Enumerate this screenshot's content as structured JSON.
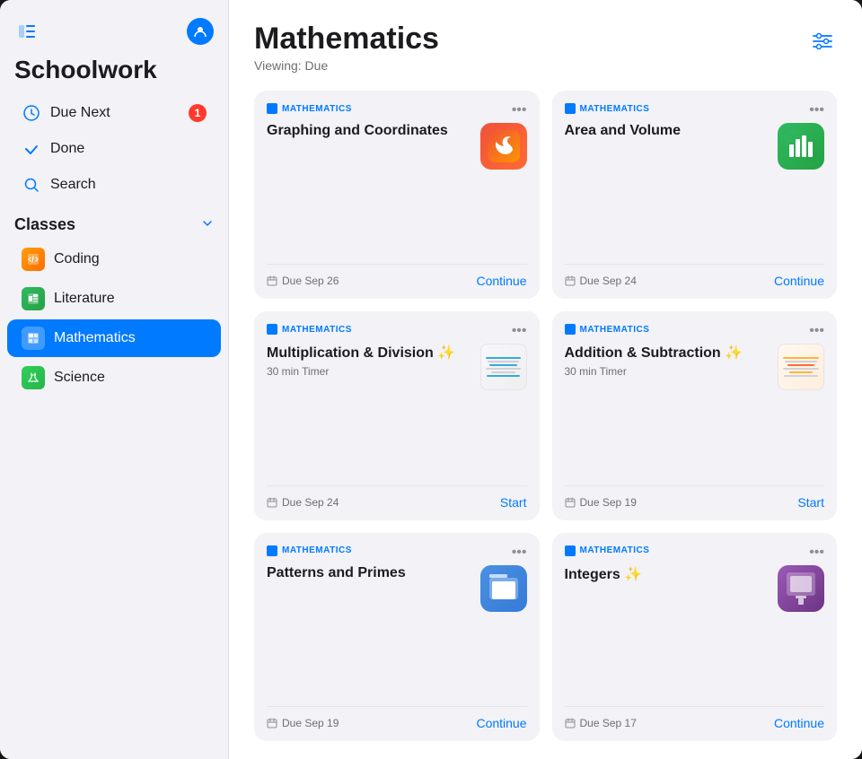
{
  "app": {
    "title": "Schoolwork"
  },
  "sidebar": {
    "toggle_icon": "sidebar-icon",
    "profile_icon": "person-icon",
    "nav_items": [
      {
        "id": "due-next",
        "label": "Due Next",
        "icon": "clock",
        "badge": "1"
      },
      {
        "id": "done",
        "label": "Done",
        "icon": "checkmark",
        "badge": null
      },
      {
        "id": "search",
        "label": "Search",
        "icon": "magnify",
        "badge": null
      }
    ],
    "classes_section": "Classes",
    "classes": [
      {
        "id": "coding",
        "label": "Coding",
        "icon": "🟧",
        "active": false
      },
      {
        "id": "literature",
        "label": "Literature",
        "icon": "📊",
        "active": false
      },
      {
        "id": "mathematics",
        "label": "Mathematics",
        "icon": "📋",
        "active": true
      },
      {
        "id": "science",
        "label": "Science",
        "icon": "🌿",
        "active": false
      }
    ]
  },
  "main": {
    "title": "Mathematics",
    "viewing_label": "Viewing: Due",
    "filter_icon": "sliders-icon",
    "cards": [
      {
        "id": "graphing",
        "category": "MATHEMATICS",
        "title": "Graphing and Coordinates",
        "subtitle": "",
        "timer": null,
        "due": "Due Sep 26",
        "action": "Continue",
        "icon_type": "swift"
      },
      {
        "id": "area-volume",
        "category": "MATHEMATICS",
        "title": "Area and Volume",
        "subtitle": "",
        "timer": null,
        "due": "Due Sep 24",
        "action": "Continue",
        "icon_type": "numbers"
      },
      {
        "id": "multiplication",
        "category": "MATHEMATICS",
        "title": "Multiplication & Division ✨",
        "subtitle": "30 min Timer",
        "timer": true,
        "due": "Due Sep 24",
        "action": "Start",
        "icon_type": "thumb"
      },
      {
        "id": "addition",
        "category": "MATHEMATICS",
        "title": "Addition & Subtraction ✨",
        "subtitle": "30 min Timer",
        "timer": true,
        "due": "Due Sep 19",
        "action": "Start",
        "icon_type": "thumb2"
      },
      {
        "id": "patterns",
        "category": "MATHEMATICS",
        "title": "Patterns and Primes",
        "subtitle": "",
        "timer": null,
        "due": "Due Sep 19",
        "action": "Continue",
        "icon_type": "files"
      },
      {
        "id": "integers",
        "category": "MATHEMATICS",
        "title": "Integers ✨",
        "subtitle": "",
        "timer": null,
        "due": "Due Sep 17",
        "action": "Continue",
        "icon_type": "keynote"
      }
    ]
  }
}
